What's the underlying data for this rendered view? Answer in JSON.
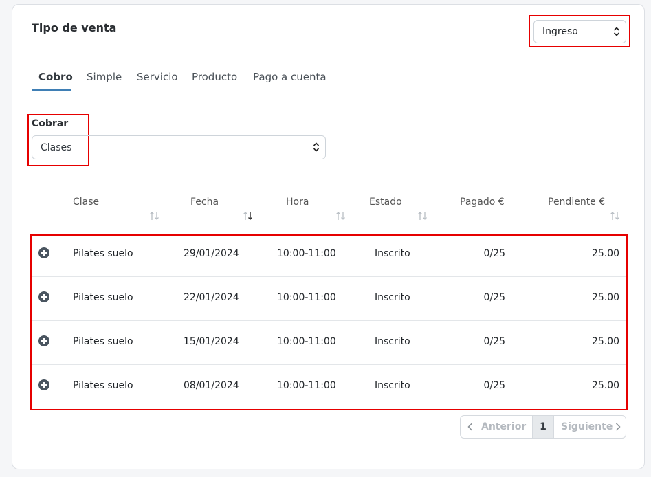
{
  "header": {
    "title": "Tipo de venta"
  },
  "tipo_select": {
    "value": "Ingreso"
  },
  "tabs": [
    {
      "label": "Cobro",
      "active": true
    },
    {
      "label": "Simple",
      "active": false
    },
    {
      "label": "Servicio",
      "active": false
    },
    {
      "label": "Producto",
      "active": false
    },
    {
      "label": "Pago a cuenta",
      "active": false
    }
  ],
  "cobrar": {
    "label": "Cobrar",
    "value": "Clases"
  },
  "table": {
    "columns": [
      "Clase",
      "Fecha",
      "Hora",
      "Estado",
      "Pagado €",
      "Pendiente €"
    ],
    "sorted_column": "Fecha",
    "rows": [
      {
        "clase": "Pilates suelo",
        "fecha": "29/01/2024",
        "hora": "10:00-11:00",
        "estado": "Inscrito",
        "pagado": "0/25",
        "pendiente": "25.00"
      },
      {
        "clase": "Pilates suelo",
        "fecha": "22/01/2024",
        "hora": "10:00-11:00",
        "estado": "Inscrito",
        "pagado": "0/25",
        "pendiente": "25.00"
      },
      {
        "clase": "Pilates suelo",
        "fecha": "15/01/2024",
        "hora": "10:00-11:00",
        "estado": "Inscrito",
        "pagado": "0/25",
        "pendiente": "25.00"
      },
      {
        "clase": "Pilates suelo",
        "fecha": "08/01/2024",
        "hora": "10:00-11:00",
        "estado": "Inscrito",
        "pagado": "0/25",
        "pendiente": "25.00"
      }
    ]
  },
  "pagination": {
    "prev_label": "Anterior",
    "current_page": "1",
    "next_label": "Siguiente"
  },
  "colors": {
    "highlight": "#e60000",
    "active_tab": "#3f7fb5",
    "icon": "#4a5560"
  },
  "icons": [
    "updown-icon",
    "sort-icon",
    "plus-circle-icon",
    "chevron-left-icon",
    "chevron-right-icon"
  ]
}
